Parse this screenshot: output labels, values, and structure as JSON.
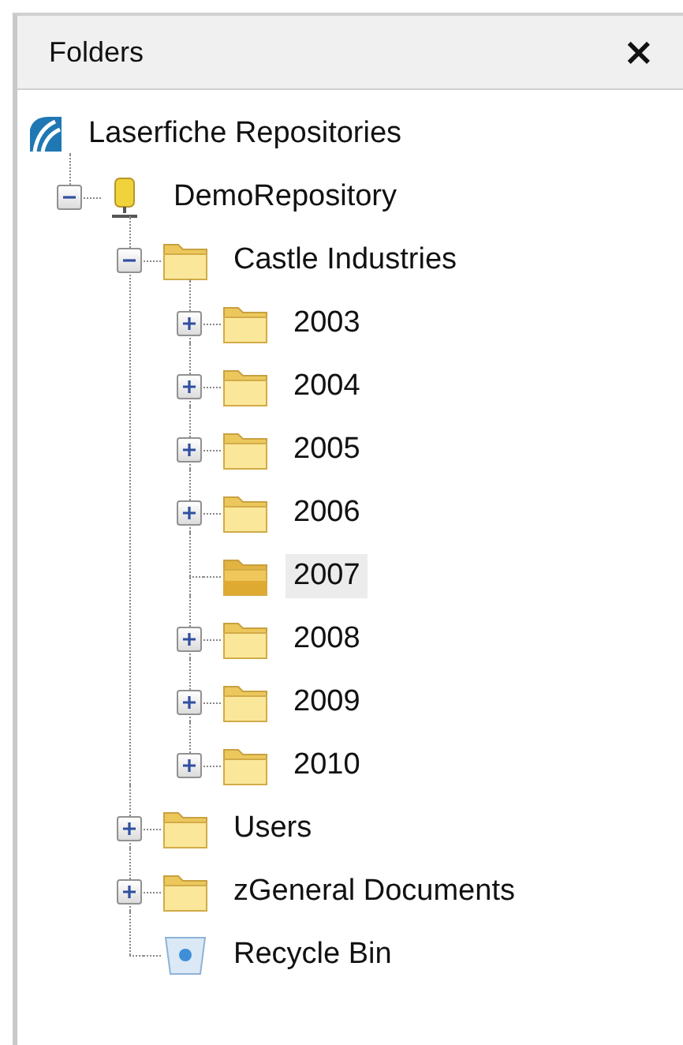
{
  "panel": {
    "title": "Folders",
    "close": "×"
  },
  "tree": [
    {
      "label": "Laserfiche Repositories",
      "kind": "root",
      "children": [
        {
          "label": "DemoRepository",
          "kind": "repository",
          "expanded": true,
          "selected": false,
          "children": [
            {
              "label": "Castle Industries",
              "kind": "folder",
              "expanded": true,
              "selected": false,
              "children": [
                {
                  "label": "2003",
                  "kind": "folder",
                  "expanded": false,
                  "selected": false
                },
                {
                  "label": "2004",
                  "kind": "folder",
                  "expanded": false,
                  "selected": false
                },
                {
                  "label": "2005",
                  "kind": "folder",
                  "expanded": false,
                  "selected": false
                },
                {
                  "label": "2006",
                  "kind": "folder",
                  "expanded": false,
                  "selected": false
                },
                {
                  "label": "2007",
                  "kind": "folder",
                  "selected": true
                },
                {
                  "label": "2008",
                  "kind": "folder",
                  "expanded": false,
                  "selected": false
                },
                {
                  "label": "2009",
                  "kind": "folder",
                  "expanded": false,
                  "selected": false
                },
                {
                  "label": "2010",
                  "kind": "folder",
                  "expanded": false,
                  "selected": false
                }
              ]
            },
            {
              "label": "Users",
              "kind": "folder",
              "expanded": false,
              "selected": false
            },
            {
              "label": "zGeneral Documents",
              "kind": "folder",
              "expanded": false,
              "selected": false
            },
            {
              "label": "Recycle Bin",
              "kind": "recycle-bin",
              "selected": false
            }
          ]
        }
      ]
    }
  ]
}
